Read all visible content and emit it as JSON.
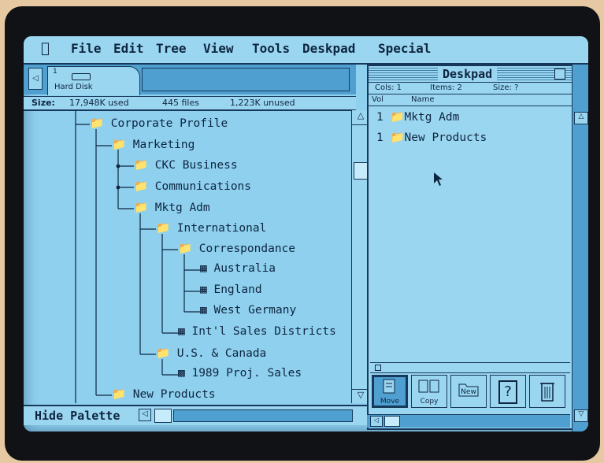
{
  "menubar": {
    "items": [
      "File",
      "Edit",
      "Tree",
      "View",
      "Tools",
      "Deskpad",
      "Special"
    ]
  },
  "tab": {
    "number": "1",
    "label": "Hard Disk"
  },
  "sizebar": {
    "label": "Size:",
    "used": "17,948K used",
    "files": "445 files",
    "unused": "1,223K unused"
  },
  "tree": {
    "nodes": [
      {
        "label": "Corporate Profile",
        "icon": "folder-icon"
      },
      {
        "label": "Marketing",
        "icon": "folder-icon"
      },
      {
        "label": "CKC Business",
        "icon": "folder-icon"
      },
      {
        "label": "Communications",
        "icon": "folder-icon"
      },
      {
        "label": "Mktg Adm",
        "icon": "folder-icon"
      },
      {
        "label": "International",
        "icon": "folder-icon"
      },
      {
        "label": "Correspondance",
        "icon": "folder-icon"
      },
      {
        "label": "Australia",
        "icon": "document-icon"
      },
      {
        "label": "England",
        "icon": "document-icon"
      },
      {
        "label": "West Germany",
        "icon": "document-icon"
      },
      {
        "label": "Int'l Sales Districts",
        "icon": "document-icon"
      },
      {
        "label": "U.S. & Canada",
        "icon": "folder-icon"
      },
      {
        "label": "1989 Proj. Sales",
        "icon": "spreadsheet-icon"
      },
      {
        "label": "New Products",
        "icon": "folder-icon"
      }
    ]
  },
  "hidebar": {
    "label": "Hide Palette"
  },
  "deskpad": {
    "title": "Deskpad",
    "stats": {
      "cols": "Cols: 1",
      "items": "Items: 2",
      "size": "Size: ?"
    },
    "columns": {
      "vol": "Vol",
      "name": "Name"
    },
    "items": [
      {
        "vol": "1",
        "name": "Mktg Adm"
      },
      {
        "vol": "1",
        "name": "New Products"
      }
    ],
    "palette": [
      {
        "label": "Move",
        "icon": "move-icon"
      },
      {
        "label": "Copy",
        "icon": "copy-icon"
      },
      {
        "label": "New",
        "icon": "new-folder-icon"
      },
      {
        "label": "",
        "icon": "help-icon",
        "glyph": "?"
      },
      {
        "label": "",
        "icon": "trash-icon"
      }
    ]
  },
  "colors": {
    "screen": "#8ed0ee",
    "panel": "#9bd6f0",
    "dark": "#17385a",
    "text": "#0e2540",
    "accent": "#4fa0d0"
  }
}
